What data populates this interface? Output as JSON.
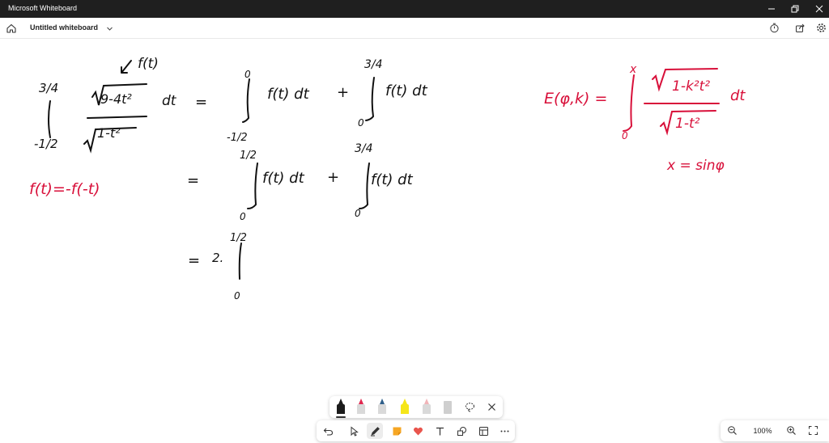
{
  "window": {
    "app_title": "Microsoft Whiteboard"
  },
  "command_bar": {
    "board_title": "Untitled whiteboard"
  },
  "ink_colors": {
    "black": "#111111",
    "red": "#d8103a"
  },
  "whiteboard_text": {
    "upper_limit_1": "3/4",
    "lower_limit_1": "-1/2",
    "numerator_1": "9-4t²",
    "denominator_1": "1-t²",
    "dt": "dt",
    "label_ft": "f(t)",
    "equals": "=",
    "plus": "+",
    "zero": "0",
    "half": "1/2",
    "integrand_ft": "f(t) dt",
    "two": "2.",
    "odd_relation": "f(t)=-f(-t)",
    "elliptic_lhs": "E(φ,k) =",
    "upper_x": "x",
    "elliptic_numerator": "1-k²t²",
    "elliptic_denominator": "1-t²",
    "substitution": "x = sinφ"
  },
  "pen_tray": {
    "pens": [
      {
        "name": "black-pen",
        "color": "#1b1b1b",
        "selected": true
      },
      {
        "name": "red-pen",
        "color": "#e0284f",
        "selected": false
      },
      {
        "name": "blue-pen",
        "color": "#2f5f8a",
        "selected": false
      },
      {
        "name": "yellow-highlighter",
        "color": "#f5e61a",
        "selected": false
      },
      {
        "name": "pink-eraser",
        "color": "#f1b4b8",
        "selected": false
      },
      {
        "name": "ruler",
        "color": "#cfcfcf",
        "selected": false
      }
    ]
  },
  "zoom": {
    "level": "100%"
  }
}
